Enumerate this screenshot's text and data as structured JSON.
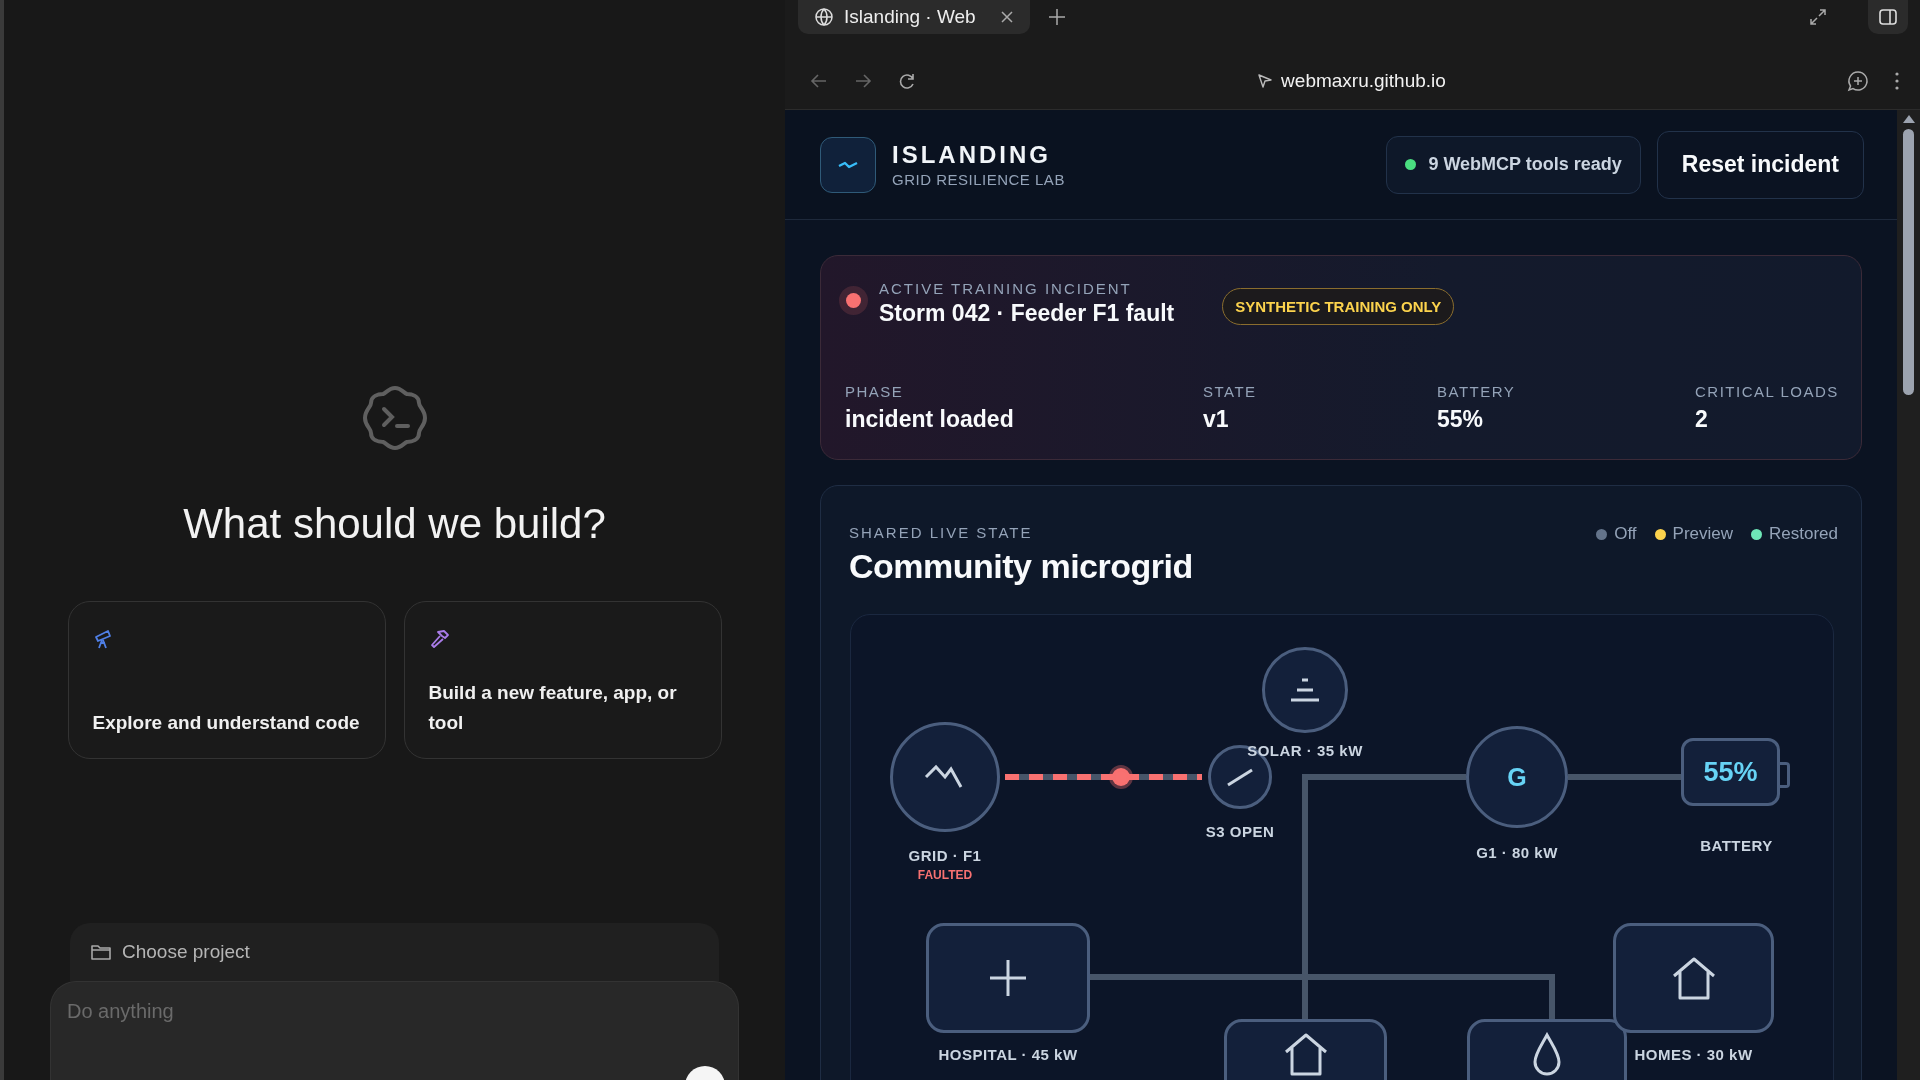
{
  "assistant": {
    "heading": "What should we build?",
    "cards": [
      {
        "kind": "explore",
        "label": "Explore and understand code"
      },
      {
        "kind": "build",
        "label": "Build a new feature, app, or tool"
      }
    ],
    "project_button": "Choose project",
    "prompt": {
      "placeholder": "Do anything"
    }
  },
  "browser": {
    "tabs": [
      {
        "title": "Islanding · Web",
        "selected": true
      }
    ],
    "address": "webmaxru.github.io"
  },
  "app": {
    "title": "ISLANDING",
    "subtitle": "GRID RESILIENCE LAB",
    "tools_status": {
      "label": "9 WebMCP tools ready",
      "color": "#4ade80"
    },
    "reset_button": "Reset incident",
    "incident": {
      "eyebrow": "ACTIVE TRAINING INCIDENT",
      "title": "Storm 042 · Feeder F1 fault",
      "badge": "SYNTHETIC TRAINING ONLY",
      "stats": [
        {
          "label": "PHASE",
          "value": "incident loaded"
        },
        {
          "label": "STATE",
          "value": "v1"
        },
        {
          "label": "BATTERY",
          "value": "55%"
        },
        {
          "label": "CRITICAL LOADS",
          "value": "2"
        }
      ]
    },
    "microgrid": {
      "eyebrow": "SHARED LIVE STATE",
      "title": "Community microgrid",
      "legend": [
        {
          "label": "Off",
          "color": "#64748b"
        },
        {
          "label": "Preview",
          "color": "#fcd34d"
        },
        {
          "label": "Restored",
          "color": "#6ee7b7"
        }
      ],
      "nodes": [
        {
          "kind": "grid",
          "label": "GRID · F1",
          "status": "FAULTED"
        },
        {
          "kind": "switch",
          "label": "S3 OPEN"
        },
        {
          "kind": "solar",
          "label": "SOLAR · 35 kW"
        },
        {
          "kind": "generator",
          "symbol": "G",
          "label": "G1 · 80 kW"
        },
        {
          "kind": "battery",
          "reading": "55%",
          "label": "BATTERY"
        },
        {
          "kind": "hospital",
          "label": "HOSPITAL · 45 kW"
        },
        {
          "kind": "shelter"
        },
        {
          "kind": "water"
        },
        {
          "kind": "homes",
          "label": "HOMES · 30 kW"
        }
      ]
    }
  }
}
